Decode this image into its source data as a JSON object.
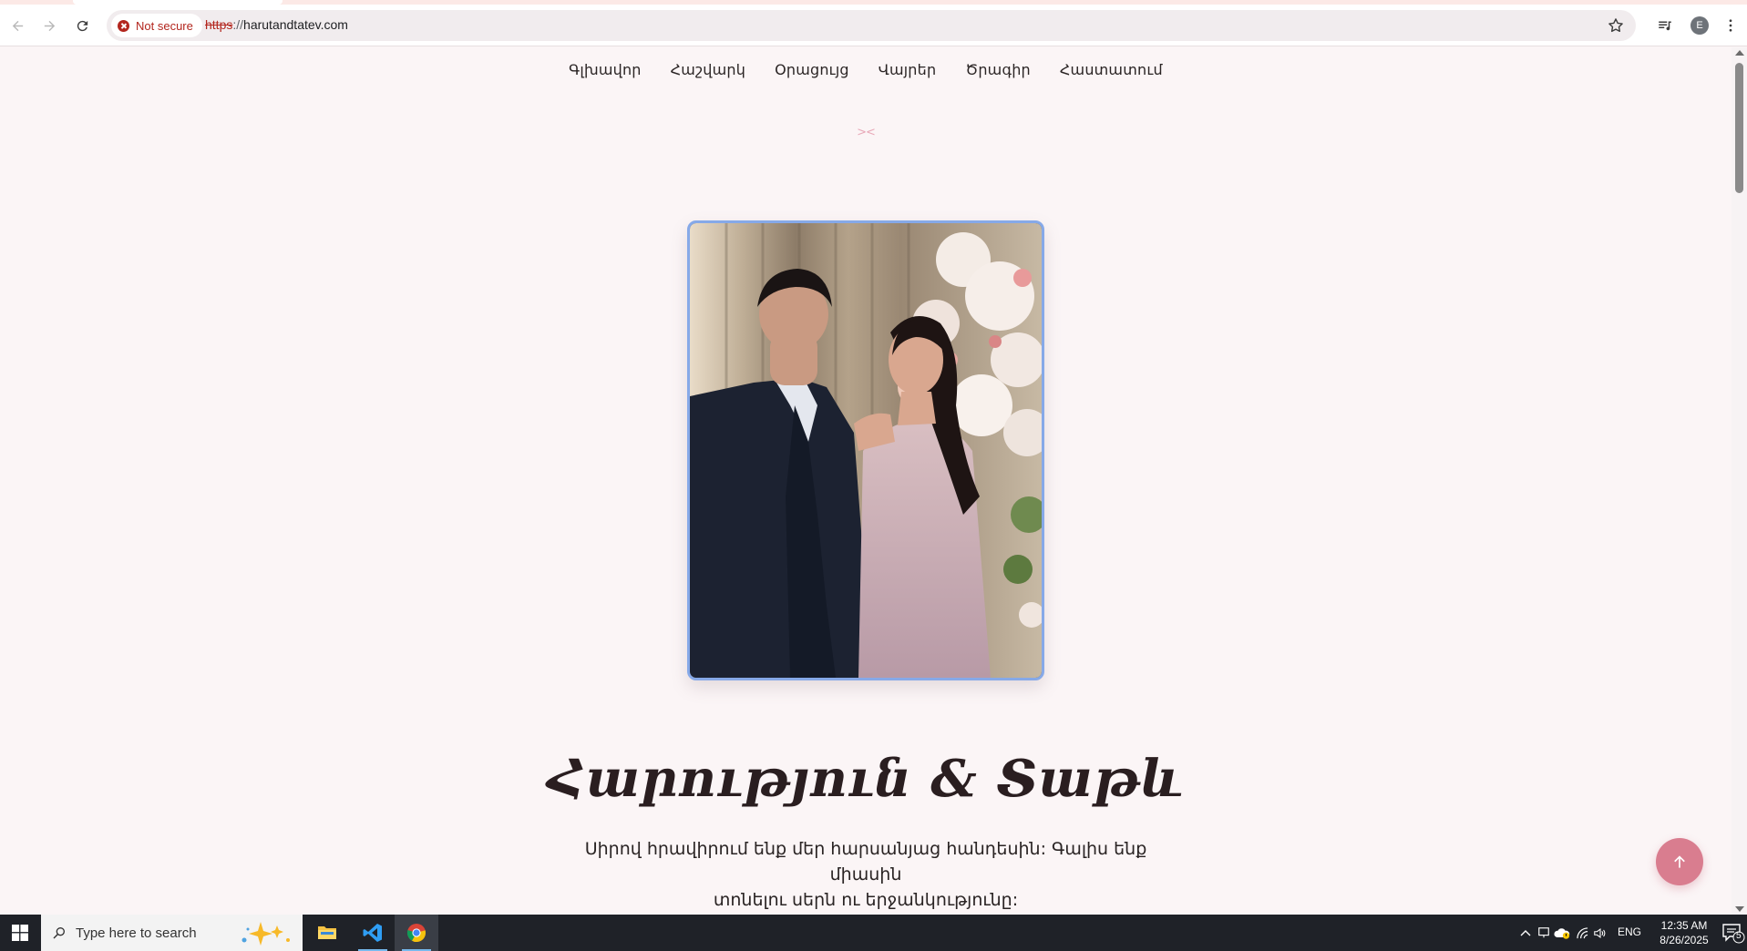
{
  "browser": {
    "security_label": "Not secure",
    "url_scheme": "https",
    "url_sep": "://",
    "url_host": "harutandtatev.com",
    "profile_initial": "E"
  },
  "site": {
    "nav": [
      "Գլխավոր",
      "Հաշվարկ",
      "Օրացույց",
      "Վայրեր",
      "Ծրագիր",
      "Հաստատում"
    ],
    "ornament": "><",
    "title": "Հարություն & Տաթև",
    "invite_line1": "Սիրով հրավիրում ենք մեր հարսանյաց հանդեսին: Գալիս ենք միասին",
    "invite_line2": "տոնելու սերն ու երջանկությունը:"
  },
  "colors": {
    "accent": "#d97d8f",
    "photo_border": "#86a9e8",
    "page_bg": "#fbf5f6"
  },
  "taskbar": {
    "search_placeholder": "Type here to search",
    "language": "ENG",
    "time": "12:35 AM",
    "date": "8/26/2025",
    "notification_count": "5"
  }
}
